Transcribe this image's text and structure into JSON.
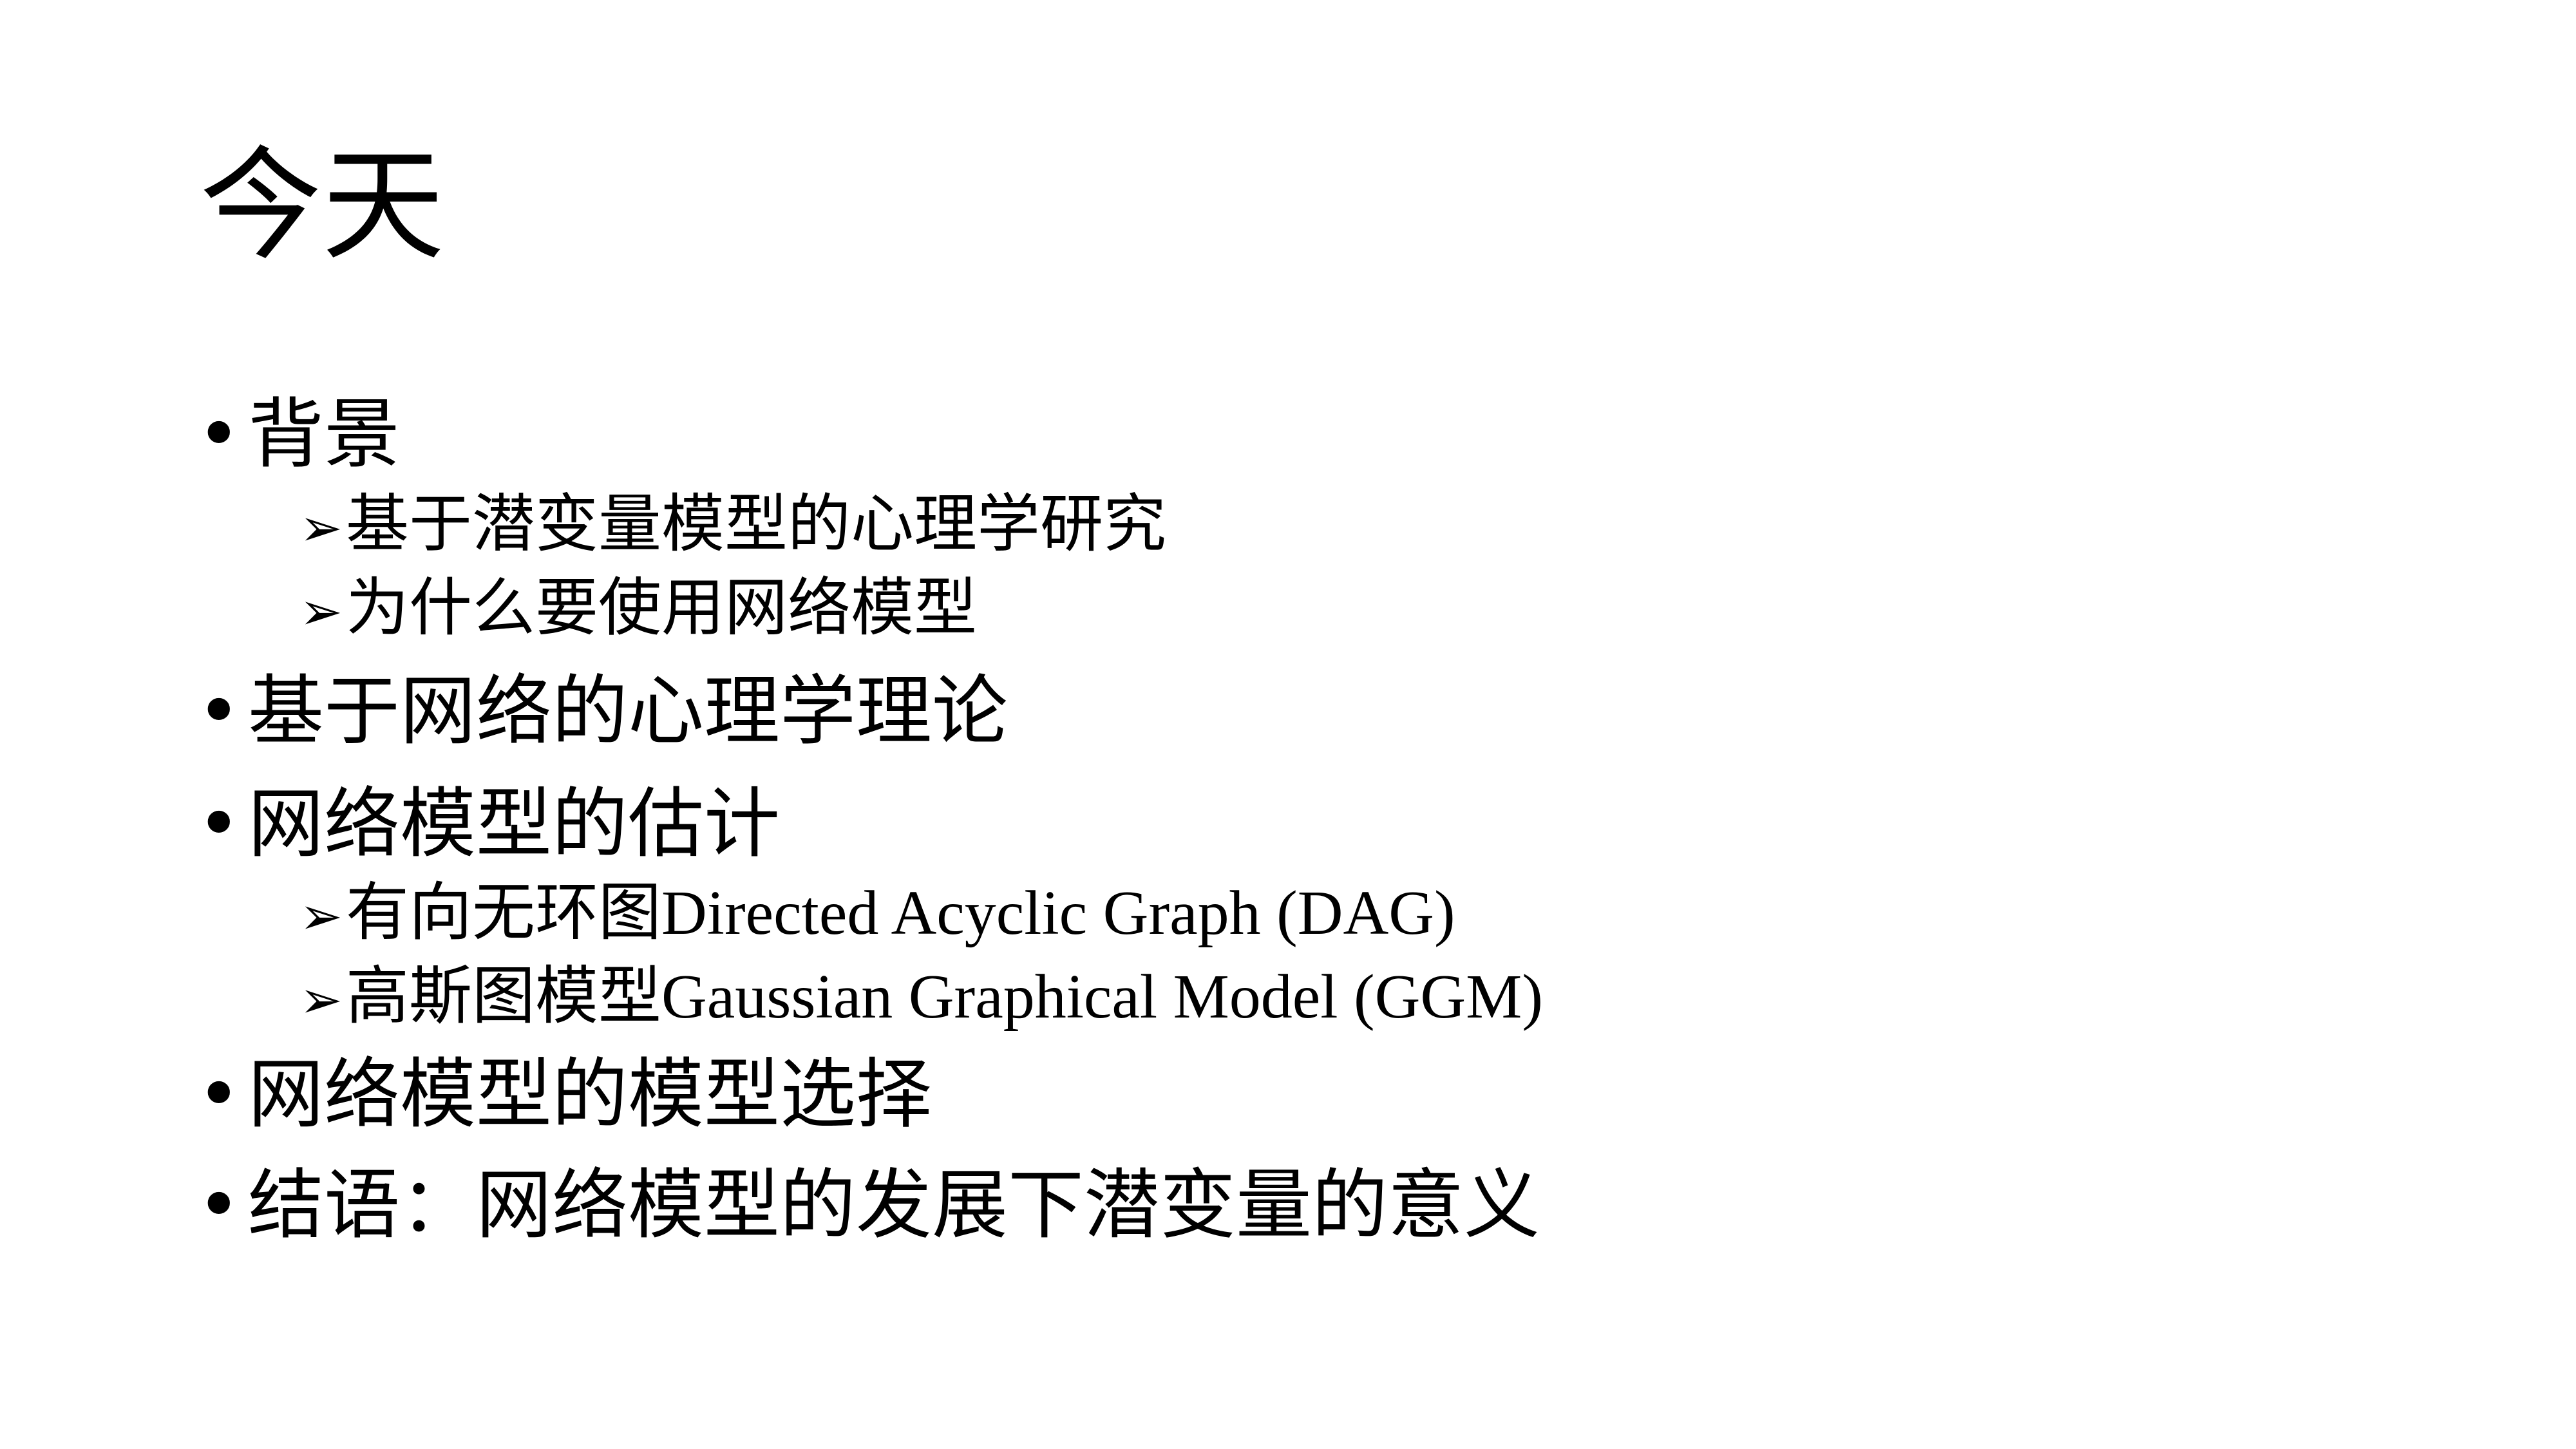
{
  "slide": {
    "title": "今天",
    "bullet_glyph": "•",
    "arrow_glyph": "➢",
    "items": {
      "background": "背景",
      "background_sub_1": "基于潜变量模型的心理学研究",
      "background_sub_2": "为什么要使用网络模型",
      "theory": "基于网络的心理学理论",
      "estimation": "网络模型的估计",
      "estimation_sub_1_zh": "有向无环图",
      "estimation_sub_1_en": "Directed Acyclic Graph (DAG)",
      "estimation_sub_2_zh": "高斯图模型",
      "estimation_sub_2_en": "Gaussian Graphical Model (GGM)",
      "selection": "网络模型的模型选择",
      "conclusion": "结语：网络模型的发展下潜变量的意义"
    }
  }
}
